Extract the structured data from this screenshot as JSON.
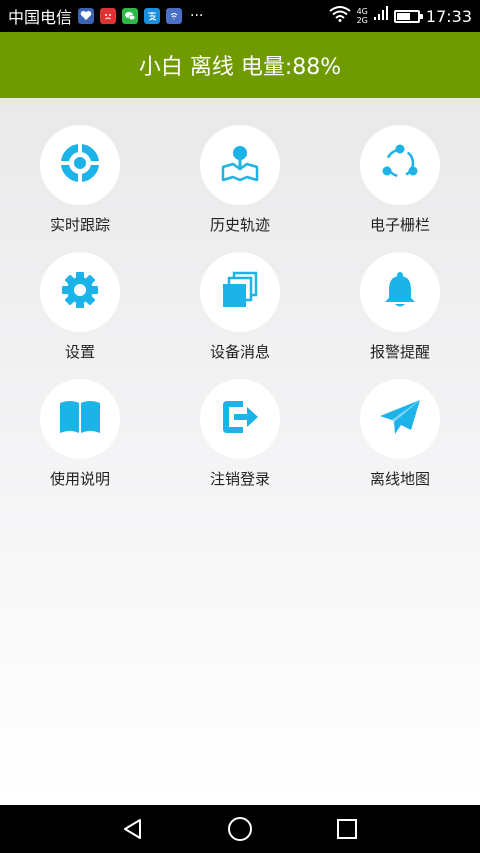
{
  "status_bar": {
    "carrier": "中国电信",
    "network_top": "4G",
    "network_bottom": "2G",
    "time": "17:33",
    "more": "···",
    "battery_level_pct": 70,
    "notification_icons": [
      "health-app-icon",
      "angry-face-icon",
      "wechat-icon",
      "alipay-icon",
      "message-icon"
    ]
  },
  "header": {
    "title": "小白 离线 电量:88%"
  },
  "menu": {
    "accent_color": "#1cb3e8",
    "items": [
      {
        "label": "实时跟踪",
        "icon": "locate-target-icon"
      },
      {
        "label": "历史轨迹",
        "icon": "map-pin-icon"
      },
      {
        "label": "电子栅栏",
        "icon": "share-nodes-icon"
      },
      {
        "label": "设置",
        "icon": "gear-icon"
      },
      {
        "label": "设备消息",
        "icon": "stacked-messages-icon"
      },
      {
        "label": "报警提醒",
        "icon": "bell-icon"
      },
      {
        "label": "使用说明",
        "icon": "open-book-icon"
      },
      {
        "label": "注销登录",
        "icon": "logout-icon"
      },
      {
        "label": "离线地图",
        "icon": "paper-plane-icon"
      }
    ]
  },
  "nav_bar": {
    "back": "back-icon",
    "home": "home-icon",
    "recents": "recents-icon"
  },
  "colors": {
    "header_bg": "#6f9a00",
    "icon_blue": "#1cb3e8"
  }
}
